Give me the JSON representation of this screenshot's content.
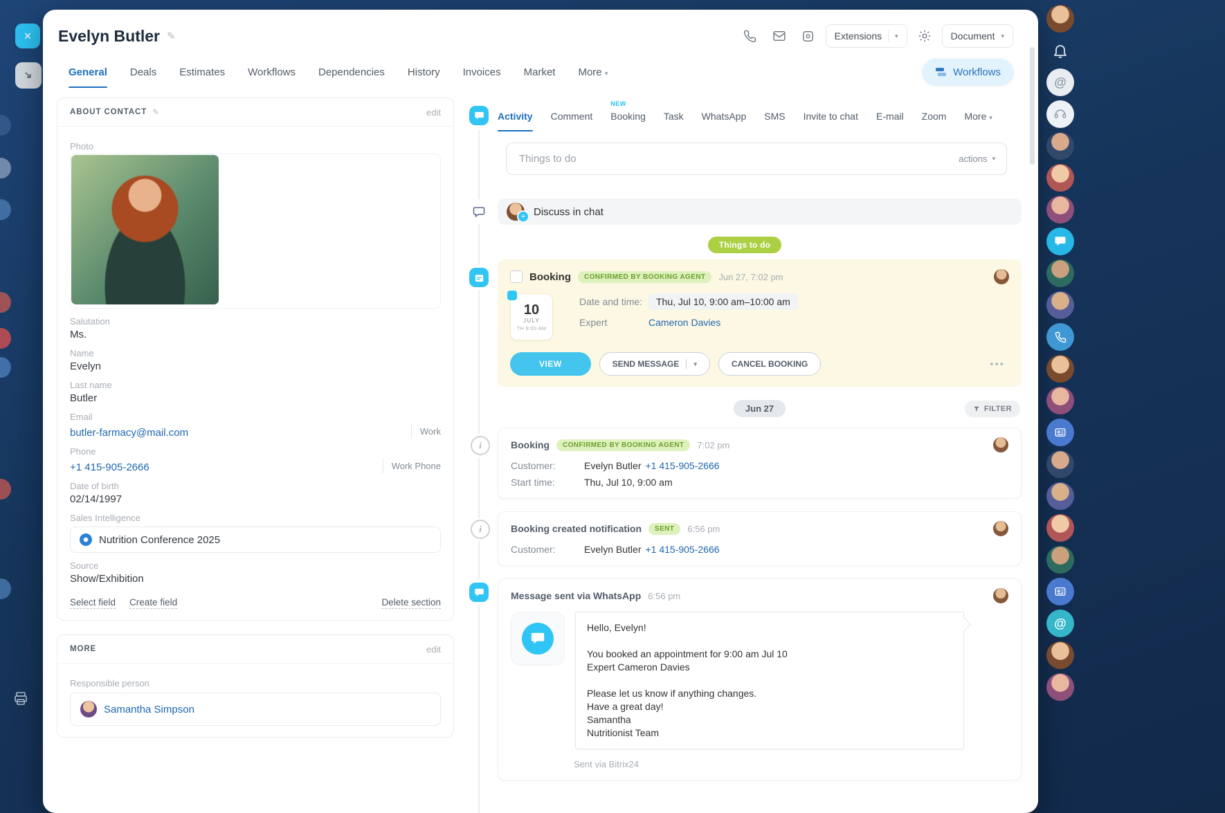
{
  "colors": {
    "accent_blue": "#1d6fc0",
    "link_blue": "#2067b0",
    "primary_cyan": "#2fc6f6",
    "stage_green": "#abd043",
    "badge_green_bg": "#ddf1bd",
    "badge_green_text": "#6f9e2f",
    "highlight_yellow": "#fcf8e3",
    "sidebar_navy": "#16355b"
  },
  "icons": [
    "close-icon",
    "collapse-icon",
    "phone-icon",
    "mail-icon",
    "copilot-icon",
    "settings-gear-icon",
    "bell-icon",
    "printer-icon",
    "chat-bubble-icon",
    "booking-calendar-icon",
    "info-icon",
    "filter-funnel-icon",
    "workflows-icon",
    "plus-icon",
    "target-icon"
  ],
  "header": {
    "title": "Evelyn Butler",
    "extensions_label": "Extensions",
    "document_label": "Document"
  },
  "main_tabs": {
    "items": [
      "General",
      "Deals",
      "Estimates",
      "Workflows",
      "Dependencies",
      "History",
      "Invoices",
      "Market",
      "More"
    ],
    "workflows_button": "Workflows"
  },
  "about": {
    "title": "ABOUT CONTACT",
    "edit": "edit",
    "photo_label": "Photo",
    "salutation_label": "Salutation",
    "salutation": "Ms.",
    "name_label": "Name",
    "name": "Evelyn",
    "last_name_label": "Last name",
    "last_name": "Butler",
    "email_label": "Email",
    "email": "butler-farmacy@mail.com",
    "email_tag": "Work",
    "phone_label": "Phone",
    "phone": "+1 415-905-2666",
    "phone_tag": "Work Phone",
    "dob_label": "Date of birth",
    "dob": "02/14/1997",
    "si_label": "Sales Intelligence",
    "si_value": "Nutrition Conference 2025",
    "source_label": "Source",
    "source": "Show/Exhibition",
    "select_field": "Select field",
    "create_field": "Create field",
    "delete_section": "Delete section"
  },
  "more_section": {
    "title": "MORE",
    "edit": "edit",
    "responsible_label": "Responsible person",
    "responsible": "Samantha Simpson"
  },
  "timeline": {
    "tabs": [
      "Activity",
      "Comment",
      "Booking",
      "Task",
      "WhatsApp",
      "SMS",
      "Invite to chat",
      "E-mail",
      "Zoom",
      "More"
    ],
    "booking_tab_badge": "NEW",
    "todo_placeholder": "Things to do",
    "actions": "actions",
    "discuss": "Discuss in chat",
    "stage_pill": "Things to do",
    "booking": {
      "title": "Booking",
      "badge": "CONFIRMED BY BOOKING AGENT",
      "time": "Jun 27, 7:02 pm",
      "cal_day": "10",
      "cal_month": "JULY",
      "cal_time": "TH 9:00 AM",
      "dt_label": "Date and time:",
      "dt_value": "Thu, Jul 10, 9:00 am–10:00 am",
      "expert_label": "Expert",
      "expert": "Cameron Davies",
      "view": "VIEW",
      "send": "SEND MESSAGE",
      "cancel": "CANCEL BOOKING"
    },
    "date_divider": "Jun 27",
    "filter": "FILTER",
    "e1": {
      "title": "Booking",
      "badge": "CONFIRMED BY BOOKING AGENT",
      "time": "7:02 pm",
      "customer_label": "Customer:",
      "customer": "Evelyn Butler",
      "customer_phone": "+1 415-905-2666",
      "start_label": "Start time:",
      "start": "Thu, Jul 10, 9:00 am"
    },
    "e2": {
      "title": "Booking created notification",
      "badge": "SENT",
      "time": "6:56 pm",
      "customer_label": "Customer:",
      "customer": "Evelyn Butler",
      "customer_phone": "+1 415-905-2666"
    },
    "e3": {
      "title": "Message sent via WhatsApp",
      "time": "6:56 pm",
      "lines": [
        "Hello, Evelyn!",
        "",
        "You booked an appointment for 9:00 am Jul 10",
        "Expert Cameron Davies",
        "",
        "Please let us know if anything changes.",
        "Have a great day!",
        "Samantha",
        "Nutritionist Team"
      ],
      "footer": "Sent via Bitrix24"
    }
  }
}
